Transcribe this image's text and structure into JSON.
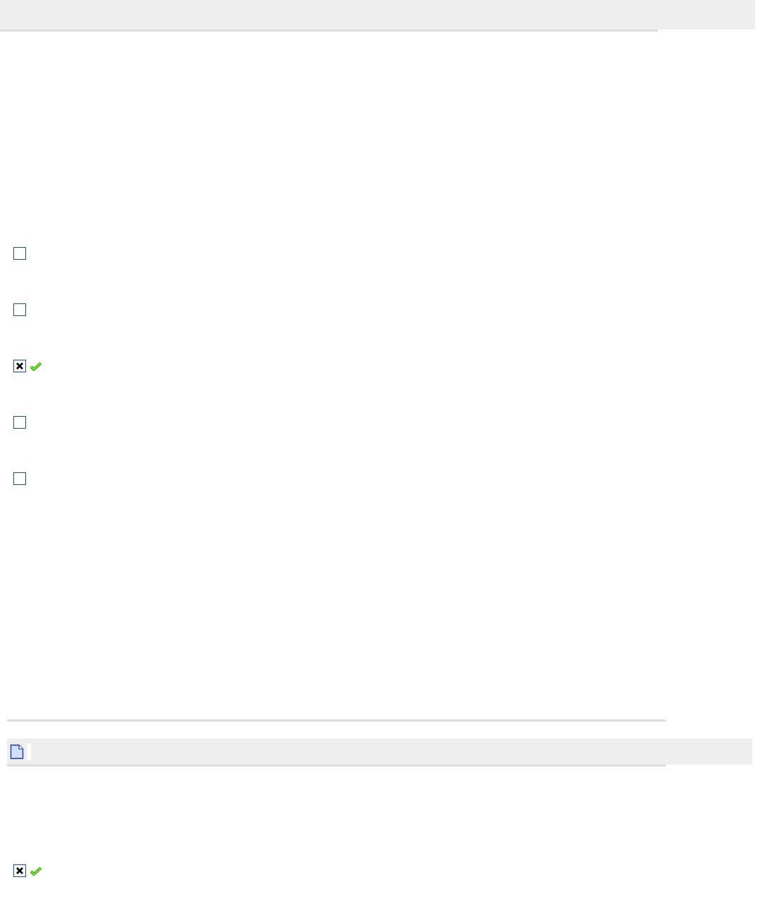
{
  "question_1": {
    "options": [
      {
        "checked": false,
        "correct": false
      },
      {
        "checked": false,
        "correct": false
      },
      {
        "checked": true,
        "correct": true
      },
      {
        "checked": false,
        "correct": false
      },
      {
        "checked": false,
        "correct": false
      }
    ]
  },
  "question_2": {
    "options": [
      {
        "checked": true,
        "correct": true
      }
    ]
  }
}
